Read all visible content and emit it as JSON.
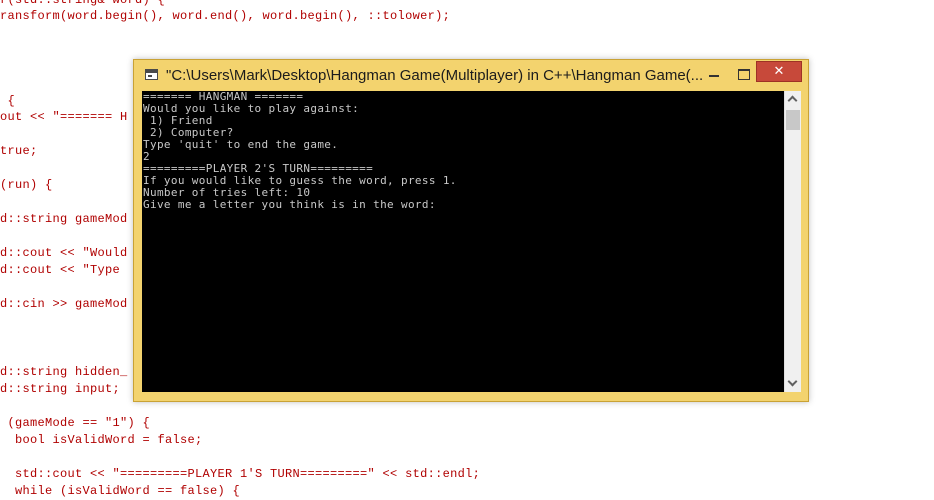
{
  "editor": {
    "lines": [
      {
        "class": "c-red",
        "text": "r(std::string& word) {"
      },
      {
        "class": "c-red",
        "text": "ransform(word.begin(), word.end(), word.begin(), ::tolower);"
      },
      {
        "class": "c-red",
        "text": " {"
      },
      {
        "class": "c-red",
        "text": "out << \"======= H"
      },
      {
        "class": "c-red",
        "text": "true;"
      },
      {
        "class": "c-red",
        "text": "(run) {"
      },
      {
        "class": "c-red",
        "text": "d::string gameMod"
      },
      {
        "class": "c-red",
        "text": "d::cout << \"Would"
      },
      {
        "class": "c-red",
        "text": "d::cout << \"Type"
      },
      {
        "class": "c-red",
        "text": "d::cin >> gameMod"
      },
      {
        "class": "c-red",
        "text": "d::string hidden_"
      },
      {
        "class": "c-red",
        "text": "d::string input;"
      },
      {
        "class": "c-red",
        "text": " (gameMode == \"1\") {"
      },
      {
        "class": "c-red",
        "text": "  bool isValidWord = false;"
      },
      {
        "class": "c-red",
        "text": "  std::cout << \"=========PLAYER 1'S TURN=========\" << std::endl;"
      },
      {
        "class": "c-red",
        "text": "  while (isValidWord == false) {"
      }
    ]
  },
  "window": {
    "title": "\"C:\\Users\\Mark\\Desktop\\Hangman Game(Multiplayer) in C++\\Hangman Game(...",
    "close_label": "✕",
    "icon": "console-app-icon"
  },
  "console": {
    "lines": [
      "======= HANGMAN =======",
      "Would you like to play against:",
      " 1) Friend",
      " 2) Computer?",
      "Type 'quit' to end the game.",
      "2",
      "=========PLAYER 2'S TURN=========",
      "If you would like to guess the word, press 1.",
      "Number of tries left: 10",
      "Give me a letter you think is in the word:"
    ]
  },
  "colors": {
    "title_bar": "#f3d36e",
    "close_button": "#c7493a",
    "console_bg": "#000000",
    "console_text": "#c8c8c8"
  }
}
